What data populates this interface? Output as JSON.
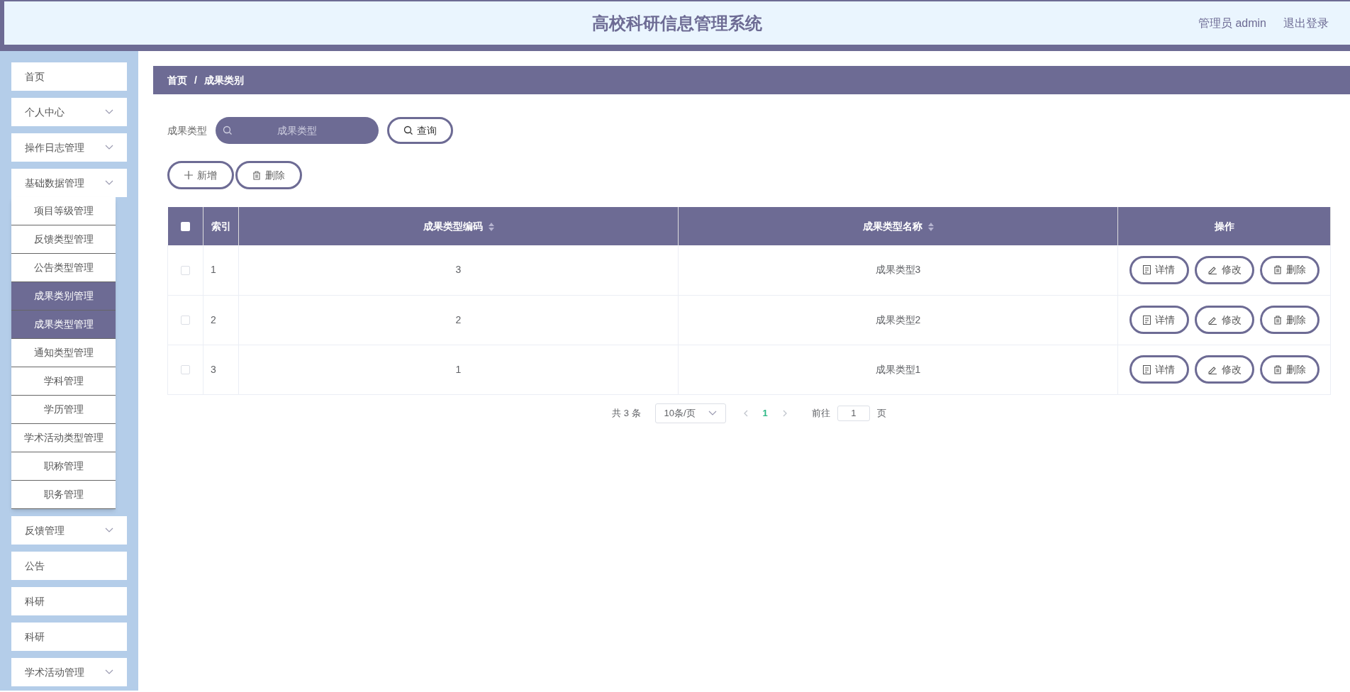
{
  "header": {
    "title": "高校科研信息管理系统",
    "user": "管理员 admin",
    "logout": "退出登录"
  },
  "sidebar": {
    "items": [
      {
        "label": "首页",
        "arrow": false
      },
      {
        "label": "个人中心",
        "arrow": true
      },
      {
        "label": "操作日志管理",
        "arrow": true
      },
      {
        "label": "基础数据管理",
        "arrow": true,
        "children": [
          {
            "label": "项目等级管理",
            "selected": false
          },
          {
            "label": "反馈类型管理",
            "selected": false
          },
          {
            "label": "公告类型管理",
            "selected": false
          },
          {
            "label": "成果类别管理",
            "selected": true
          },
          {
            "label": "成果类型管理",
            "selected": true
          },
          {
            "label": "通知类型管理",
            "selected": false
          },
          {
            "label": "学科管理",
            "selected": false
          },
          {
            "label": "学历管理",
            "selected": false
          },
          {
            "label": "学术活动类型管理",
            "selected": false
          },
          {
            "label": "职称管理",
            "selected": false
          },
          {
            "label": "职务管理",
            "selected": false
          }
        ]
      },
      {
        "label": "反馈管理",
        "arrow": true
      },
      {
        "label": "公告",
        "arrow": false
      },
      {
        "label": "科研",
        "arrow": false
      },
      {
        "label": "科研",
        "arrow": false
      },
      {
        "label": "学术活动管理",
        "arrow": true
      }
    ]
  },
  "breadcrumb": [
    "首页",
    "/",
    "成果类别"
  ],
  "search": {
    "label": "成果类型",
    "placeholder": "成果类型",
    "button": "查询"
  },
  "actions": [
    "新增",
    "删除"
  ],
  "table": {
    "all_checked": false,
    "columns": [
      "索引",
      "成果类型编码",
      "成果类型名称",
      "操作"
    ],
    "rows": [
      {
        "checked": false,
        "cells": [
          "1",
          "3",
          "成果类型3"
        ],
        "buttons": [
          {
            "kind": "detail",
            "label": "详情"
          },
          {
            "kind": "edit",
            "label": "修改"
          },
          {
            "kind": "delete",
            "label": "删除"
          }
        ]
      },
      {
        "checked": false,
        "cells": [
          "2",
          "2",
          "成果类型2"
        ],
        "buttons": [
          {
            "kind": "detail",
            "label": "详情"
          },
          {
            "kind": "edit",
            "label": "修改"
          },
          {
            "kind": "delete",
            "label": "删除"
          }
        ]
      },
      {
        "checked": false,
        "cells": [
          "3",
          "1",
          "成果类型1"
        ],
        "buttons": [
          {
            "kind": "detail",
            "label": "详情"
          },
          {
            "kind": "edit",
            "label": "修改"
          },
          {
            "kind": "delete",
            "label": "删除"
          }
        ]
      }
    ]
  },
  "pagination": {
    "total": "共 3 条",
    "page_size": "10条/页",
    "pages": [
      {
        "label": "1",
        "selected": true
      }
    ],
    "goto_label": "前往",
    "goto_value": "1",
    "goto_suffix": "页"
  }
}
